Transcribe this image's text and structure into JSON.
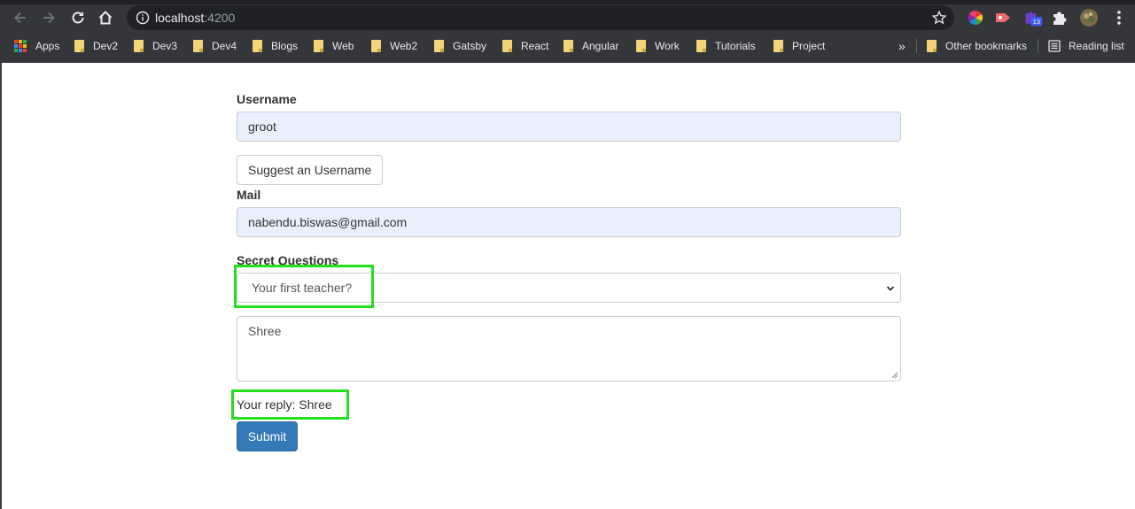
{
  "browser": {
    "url_host": "localhost",
    "url_port": ":4200",
    "extension_badge": "13"
  },
  "bookmarks": {
    "apps_label": "Apps",
    "items": [
      "Dev2",
      "Dev3",
      "Dev4",
      "Blogs",
      "Web",
      "Web2",
      "Gatsby",
      "React",
      "Angular",
      "Work",
      "Tutorials",
      "Project"
    ],
    "overflow": "»",
    "other_label": "Other bookmarks",
    "reading_label": "Reading list"
  },
  "form": {
    "username_label": "Username",
    "username_value": "groot",
    "suggest_button": "Suggest an Username",
    "mail_label": "Mail",
    "mail_value": "nabendu.biswas@gmail.com",
    "secret_label": "Secret Questions",
    "secret_selected": "Your first teacher?",
    "answer_value": "Shree",
    "reply_text": "Your reply: Shree",
    "submit_label": "Submit"
  },
  "colors": {
    "toolbar": "#35363a",
    "omnibox": "#202124",
    "input_autofill": "#e8f0fe",
    "primary": "#337ab7",
    "highlight": "#22e01a"
  }
}
